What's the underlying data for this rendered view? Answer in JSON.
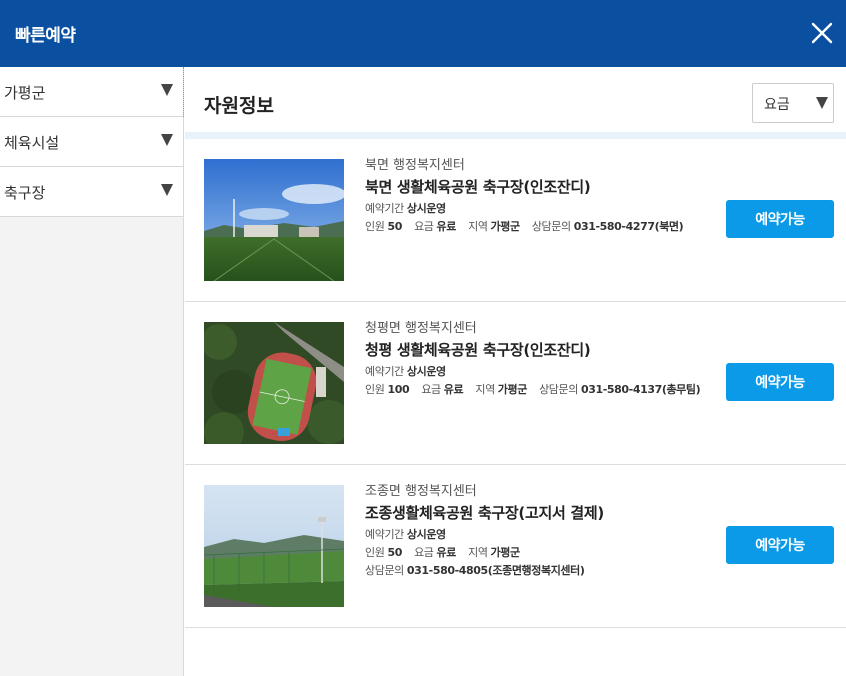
{
  "header": {
    "title": "빠른예약",
    "close_icon": "close-icon"
  },
  "sidebar": {
    "filters": [
      {
        "label": "가평군"
      },
      {
        "label": "체육시설"
      },
      {
        "label": "축구장"
      }
    ]
  },
  "main": {
    "heading": "자원정보",
    "sort": {
      "value": "요금"
    },
    "items": [
      {
        "org": "북면 행정복지센터",
        "name": "북면 생활체육공원 축구장(인조잔디)",
        "period_label": "예약기간",
        "period_value": "상시운영",
        "capacity_label": "인원",
        "capacity_value": "50",
        "fee_label": "요금",
        "fee_value": "유료",
        "region_label": "지역",
        "region_value": "가평군",
        "contact_label": "상담문의",
        "contact_value": "031-580-4277(북면)",
        "button": "예약가능"
      },
      {
        "org": "청평면 행정복지센터",
        "name": "청평 생활체육공원 축구장(인조잔디)",
        "period_label": "예약기간",
        "period_value": "상시운영",
        "capacity_label": "인원",
        "capacity_value": "100",
        "fee_label": "요금",
        "fee_value": "유료",
        "region_label": "지역",
        "region_value": "가평군",
        "contact_label": "상담문의",
        "contact_value": "031-580-4137(총무팀)",
        "button": "예약가능"
      },
      {
        "org": "조종면 행정복지센터",
        "name": "조종생활체육공원 축구장(고지서 결제)",
        "period_label": "예약기간",
        "period_value": "상시운영",
        "capacity_label": "인원",
        "capacity_value": "50",
        "fee_label": "요금",
        "fee_value": "유료",
        "region_label": "지역",
        "region_value": "가평군",
        "contact_label": "상담문의",
        "contact_value": "031-580-4805(조종면행정복지센터)",
        "button": "예약가능"
      }
    ]
  },
  "colors": {
    "header_bg": "#0a4fa0",
    "button_bg": "#0a9ae8"
  }
}
